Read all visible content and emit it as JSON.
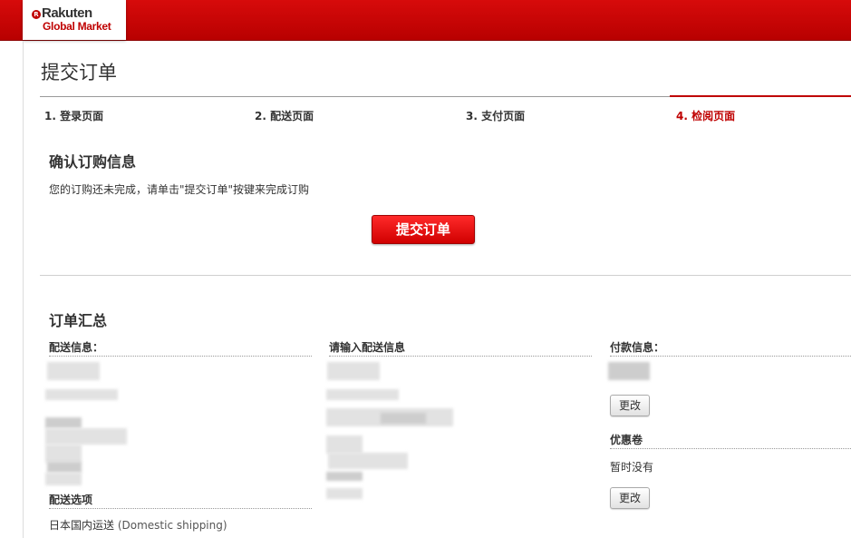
{
  "header": {
    "logo_mark": "R",
    "brand_line1": "Rakuten",
    "brand_line2": "Global Market"
  },
  "page_title": "提交订单",
  "steps": [
    {
      "label": "1. 登录页面",
      "active": false
    },
    {
      "label": "2. 配送页面",
      "active": false
    },
    {
      "label": "3. 支付页面",
      "active": false
    },
    {
      "label": "4. 检阅页面",
      "active": true
    }
  ],
  "confirm": {
    "title": "确认订购信息",
    "note": "您的订购还未完成，请单击\"提交订单\"按键来完成订购",
    "submit_label": "提交订单"
  },
  "summary": {
    "title": "订单汇总",
    "shipping_info_label": "配送信息：",
    "enter_shipping_label": "请输入配送信息",
    "payment_info_label": "付款信息：",
    "shipping_option_label": "配送选项",
    "shipping_option_value": "日本国内运送",
    "shipping_option_value_en": "(Domestic shipping)",
    "change_label": "更改",
    "coupon_label": "优惠卷",
    "coupon_value": "暂时没有"
  },
  "colors": {
    "brand_red": "#bf0000",
    "header_red": "#d70b0b"
  }
}
